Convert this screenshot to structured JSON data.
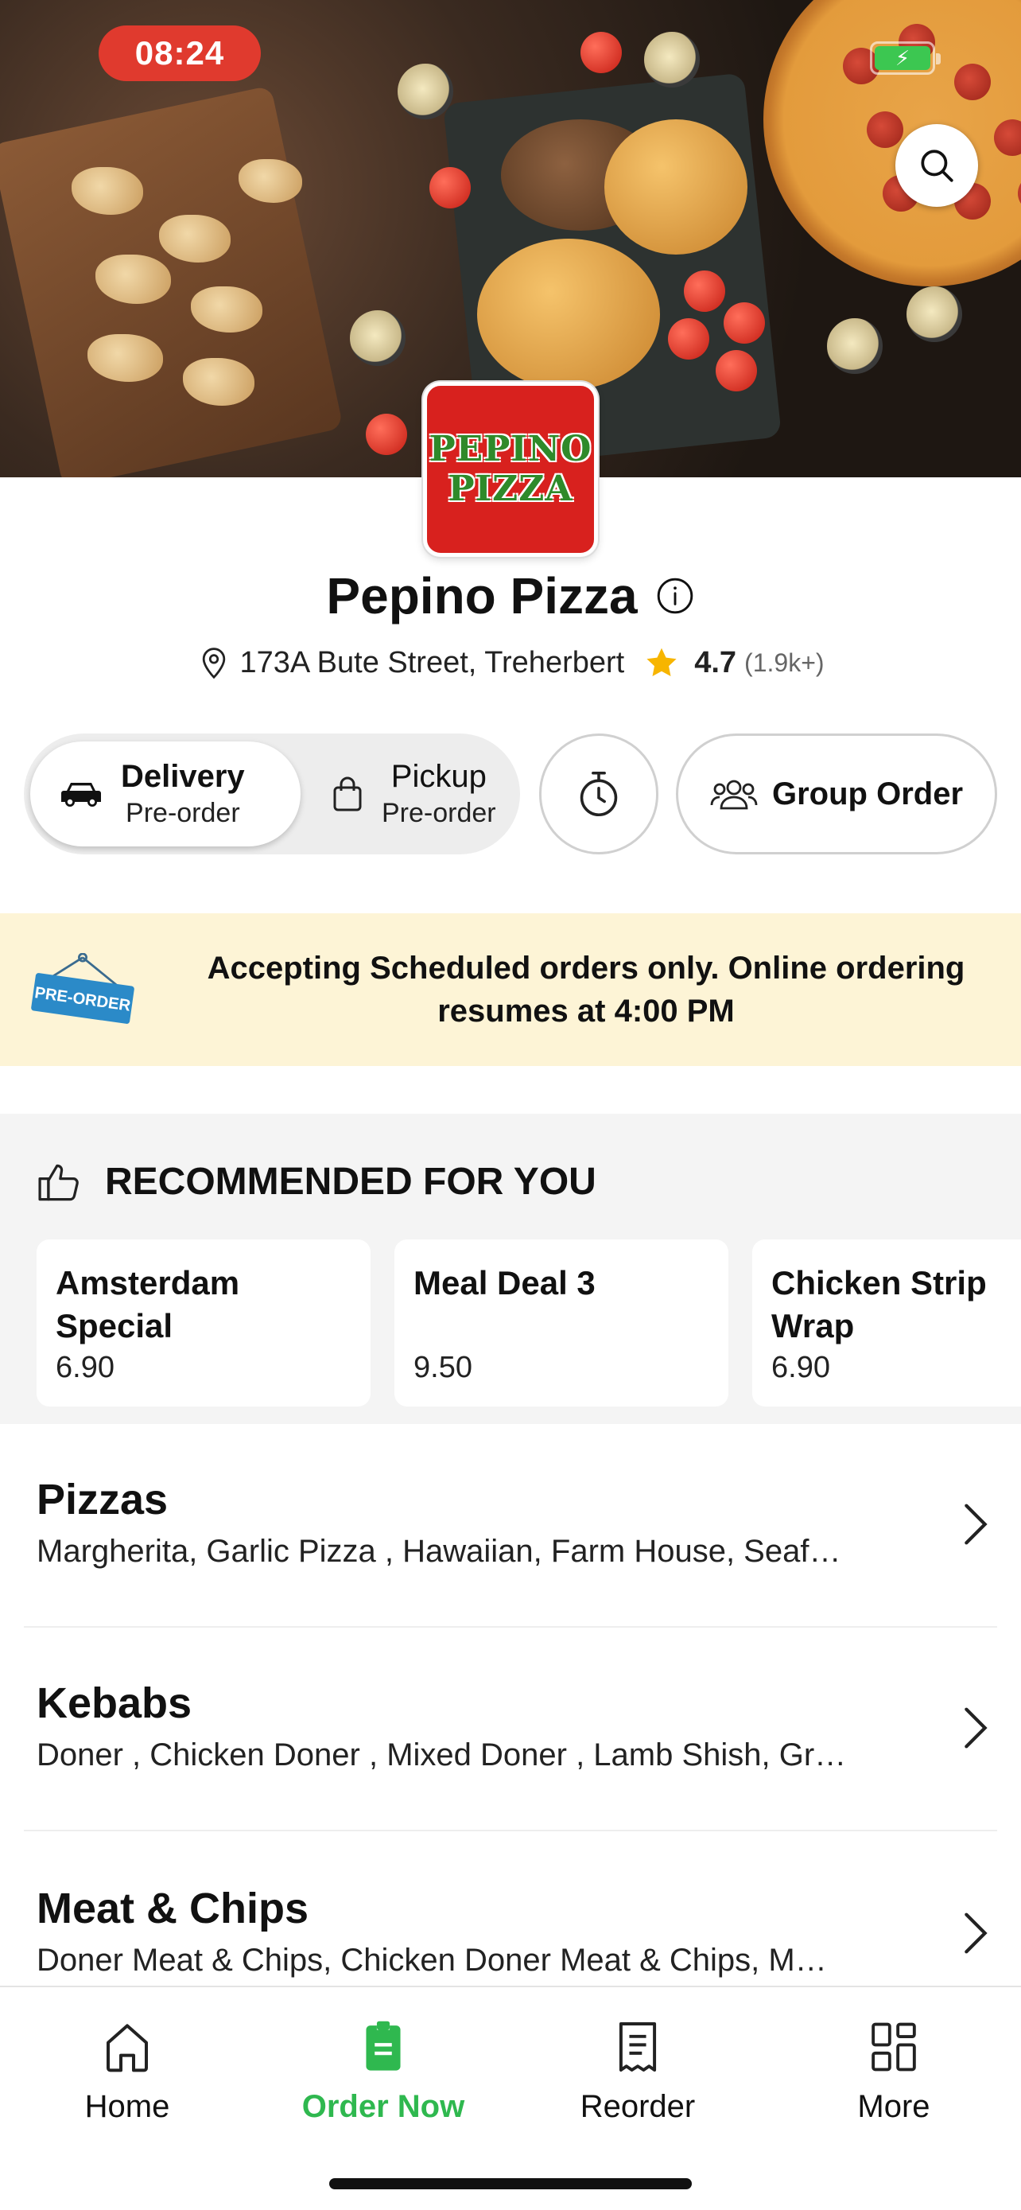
{
  "status_bar": {
    "time": "08:24"
  },
  "restaurant": {
    "logo_line1": "PEPINO",
    "logo_line2": "PIZZA",
    "name": "Pepino Pizza",
    "address": "173A Bute Street, Treherbert",
    "rating": "4.7",
    "review_count": "(1.9k+)"
  },
  "order_modes": {
    "delivery_label": "Delivery",
    "delivery_sub": "Pre-order",
    "pickup_label": "Pickup",
    "pickup_sub": "Pre-order",
    "group_order_label": "Group Order"
  },
  "banner": {
    "sign_text": "PRE-ORDER",
    "message": "Accepting Scheduled orders only. Online ordering resumes at 4:00 PM"
  },
  "recommended": {
    "title": "RECOMMENDED FOR YOU",
    "items": [
      {
        "name": "Amsterdam Special",
        "price": "6.90"
      },
      {
        "name": "Meal Deal 3",
        "price": "9.50"
      },
      {
        "name": "Chicken Strip Wrap",
        "price": "6.90"
      }
    ]
  },
  "categories": [
    {
      "title": "Pizzas",
      "desc": "Margherita, Garlic Pizza , Hawaiian, Farm House, Seaf…"
    },
    {
      "title": "Kebabs",
      "desc": "Doner , Chicken Doner , Mixed Doner , Lamb Shish, Gr…"
    },
    {
      "title": "Meat & Chips",
      "desc": "Doner Meat & Chips, Chicken Doner Meat & Chips, M…"
    }
  ],
  "tabbar": {
    "home": "Home",
    "order_now": "Order Now",
    "reorder": "Reorder",
    "more": "More"
  },
  "colors": {
    "accent_green": "#2fb84f",
    "time_pill": "#e03a2e",
    "banner_bg": "#fdf4d6",
    "star": "#f7b500",
    "logo_red": "#d8211e"
  },
  "icons": [
    "search-icon",
    "info-icon",
    "location-pin-icon",
    "star-icon",
    "car-icon",
    "shopping-bag-icon",
    "stopwatch-icon",
    "group-users-icon",
    "thumbs-up-icon",
    "chevron-right-icon",
    "home-icon",
    "order-bag-icon",
    "receipt-icon",
    "grid-icon",
    "battery-icon"
  ]
}
